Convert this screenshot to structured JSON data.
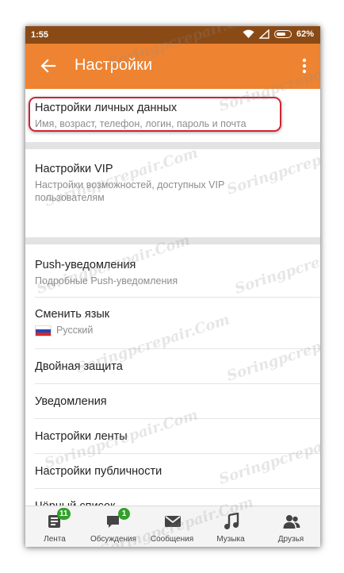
{
  "status_bar": {
    "time": "1:55",
    "battery": "62%"
  },
  "app_bar": {
    "title": "Настройки"
  },
  "settings": [
    {
      "title": "Настройки личных данных",
      "subtitle": "Имя, возраст, телефон, логин, пароль и почта"
    },
    {
      "title": "Настройки VIP",
      "subtitle": "Настройки возможностей, доступных VIP пользователям"
    },
    {
      "title": "Push-уведомления",
      "subtitle": "Подробные Push-уведомления"
    },
    {
      "title": "Сменить язык",
      "subtitle": "Русский"
    },
    {
      "title": "Двойная защита"
    },
    {
      "title": "Уведомления"
    },
    {
      "title": "Настройки ленты"
    },
    {
      "title": "Настройки публичности"
    },
    {
      "title": "Чёрный список"
    }
  ],
  "bottom_nav": [
    {
      "label": "Лента",
      "badge": "11",
      "icon": "feed-icon"
    },
    {
      "label": "Обсуждения",
      "badge": "1",
      "icon": "chat-icon"
    },
    {
      "label": "Сообщения",
      "icon": "mail-icon"
    },
    {
      "label": "Музыка",
      "icon": "music-icon"
    },
    {
      "label": "Друзья",
      "icon": "friends-icon"
    }
  ],
  "watermark": "Soringpcrepair.Com",
  "colors": {
    "accent": "#ee8331",
    "status_bar": "#8a4a16",
    "highlight": "#cf2430",
    "badge": "#32a02a"
  }
}
